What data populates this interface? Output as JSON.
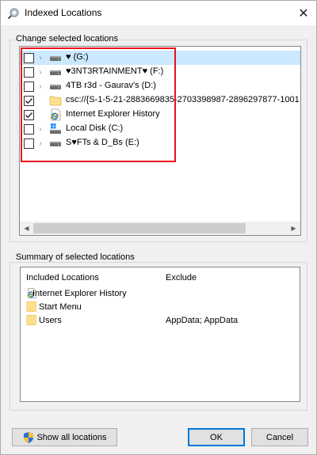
{
  "window": {
    "title": "Indexed Locations",
    "close_glyph": "✕"
  },
  "change_group": {
    "label": "Change selected locations"
  },
  "tree": {
    "items": [
      {
        "label": "♥ (G:)",
        "checked": false,
        "icon": "drive-icon",
        "expander": "›"
      },
      {
        "label": "♥3NT3RTAINMENT♥ (F:)",
        "checked": false,
        "icon": "drive-icon",
        "expander": "›"
      },
      {
        "label": "4TB r3d - Gaurav's (D:)",
        "checked": false,
        "icon": "drive-icon",
        "expander": "›"
      },
      {
        "label": "csc://{S-1-5-21-2883669835-2703398987-2896297877-1001",
        "checked": true,
        "icon": "folder-icon",
        "expander": ""
      },
      {
        "label": "Internet Explorer History",
        "checked": true,
        "icon": "ie-icon",
        "expander": ""
      },
      {
        "label": "Local Disk (C:)",
        "checked": false,
        "icon": "windows-drive-icon",
        "expander": "›"
      },
      {
        "label": "S♥FTs & D_Bs (E:)",
        "checked": false,
        "icon": "drive-icon",
        "expander": "›"
      }
    ]
  },
  "summary_group": {
    "label": "Summary of selected locations"
  },
  "summary": {
    "col_included": "Included Locations",
    "col_exclude": "Exclude",
    "rows": [
      {
        "location": "Internet Explorer History",
        "exclude": "",
        "icon": "ie-icon"
      },
      {
        "location": "Start Menu",
        "exclude": "",
        "icon": "folder-icon"
      },
      {
        "location": "Users",
        "exclude": "AppData; AppData",
        "icon": "folder-icon"
      }
    ]
  },
  "buttons": {
    "show_all": "Show all locations",
    "ok": "OK",
    "cancel": "Cancel"
  },
  "colors": {
    "highlight": "#cce8ff",
    "annotation_red": "#e8111c",
    "default_button_border": "#0078d7"
  }
}
